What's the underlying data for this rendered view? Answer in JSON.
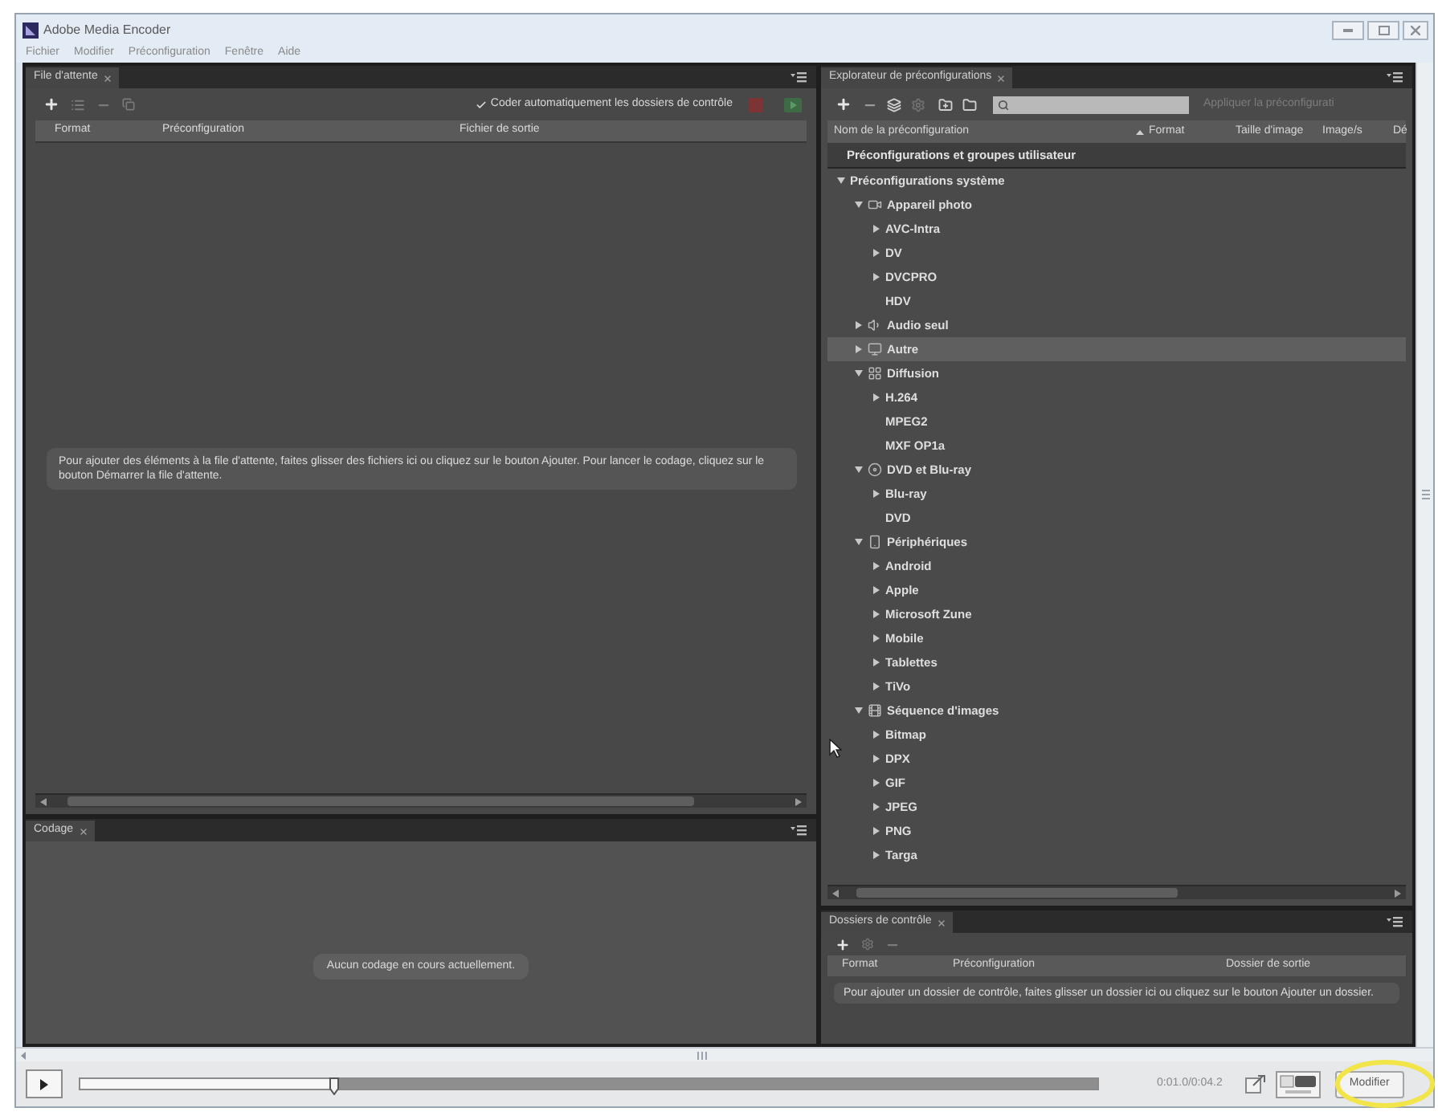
{
  "window": {
    "title": "Adobe Media Encoder"
  },
  "menu": [
    "Fichier",
    "Modifier",
    "Préconfiguration",
    "Fenêtre",
    "Aide"
  ],
  "queue": {
    "tab": "File d'attente",
    "auto_encode": {
      "label": "Coder automatiquement les dossiers de contrôle",
      "checked": true
    },
    "columns": [
      "Format",
      "Préconfiguration",
      "Fichier de sortie"
    ],
    "message": "Pour ajouter des éléments à la file d'attente, faites glisser des fichiers ici ou cliquez sur le bouton Ajouter. Pour lancer le codage, cliquez sur le bouton Démarrer la file d'attente."
  },
  "encoding": {
    "tab": "Codage",
    "message": "Aucun codage en cours actuellement."
  },
  "preset_browser": {
    "tab": "Explorateur de préconfigurations",
    "apply_label": "Appliquer la préconfigurati",
    "columns": [
      {
        "label": "Nom de la préconfiguration",
        "sorted": false
      },
      {
        "label": "Format",
        "sorted": true
      },
      {
        "label": "Taille d'image",
        "sorted": false
      },
      {
        "label": "Image/s",
        "sorted": false
      },
      {
        "label": "Dé",
        "sorted": false
      }
    ],
    "user_presets": "Préconfigurations et groupes utilisateur",
    "tree": [
      {
        "label": "Préconfigurations système",
        "kind": "group",
        "expanded": true,
        "selected": false,
        "children": [
          {
            "label": "Appareil photo",
            "kind": "group",
            "expanded": true,
            "selected": false,
            "children": [
              {
                "label": "AVC-Intra",
                "kind": "group",
                "expanded": false,
                "selected": false
              },
              {
                "label": "DV",
                "kind": "group",
                "expanded": false,
                "selected": false
              },
              {
                "label": "DVCPRO",
                "kind": "group",
                "expanded": false,
                "selected": false
              },
              {
                "label": "HDV",
                "kind": "preset",
                "selected": false
              }
            ]
          },
          {
            "label": "Audio seul",
            "kind": "group",
            "expanded": false,
            "selected": false
          },
          {
            "label": "Autre",
            "kind": "group",
            "expanded": false,
            "selected": true
          },
          {
            "label": "Diffusion",
            "kind": "group",
            "expanded": true,
            "selected": false,
            "children": [
              {
                "label": "H.264",
                "kind": "group",
                "expanded": false,
                "selected": false
              },
              {
                "label": "MPEG2",
                "kind": "preset",
                "selected": false
              },
              {
                "label": "MXF OP1a",
                "kind": "preset",
                "selected": false
              }
            ]
          },
          {
            "label": "DVD et Blu-ray",
            "kind": "group",
            "expanded": true,
            "selected": false,
            "children": [
              {
                "label": "Blu-ray",
                "kind": "group",
                "expanded": false,
                "selected": false
              },
              {
                "label": "DVD",
                "kind": "preset",
                "selected": false
              }
            ]
          },
          {
            "label": "Périphériques",
            "kind": "group",
            "expanded": true,
            "selected": false,
            "children": [
              {
                "label": "Android",
                "kind": "group",
                "expanded": false,
                "selected": false
              },
              {
                "label": "Apple",
                "kind": "group",
                "expanded": false,
                "selected": false
              },
              {
                "label": "Microsoft Zune",
                "kind": "group",
                "expanded": false,
                "selected": false
              },
              {
                "label": "Mobile",
                "kind": "group",
                "expanded": false,
                "selected": false
              },
              {
                "label": "Tablettes",
                "kind": "group",
                "expanded": false,
                "selected": false
              },
              {
                "label": "TiVo",
                "kind": "group",
                "expanded": false,
                "selected": false
              }
            ]
          },
          {
            "label": "Séquence d'images",
            "kind": "group",
            "expanded": true,
            "selected": false,
            "children": [
              {
                "label": "Bitmap",
                "kind": "group",
                "expanded": false,
                "selected": false
              },
              {
                "label": "DPX",
                "kind": "group",
                "expanded": false,
                "selected": false
              },
              {
                "label": "GIF",
                "kind": "group",
                "expanded": false,
                "selected": false
              },
              {
                "label": "JPEG",
                "kind": "group",
                "expanded": false,
                "selected": false
              },
              {
                "label": "PNG",
                "kind": "group",
                "expanded": false,
                "selected": false
              },
              {
                "label": "Targa",
                "kind": "group",
                "expanded": false,
                "selected": false
              }
            ]
          }
        ]
      }
    ]
  },
  "watch_folders": {
    "tab": "Dossiers de contrôle",
    "columns": [
      "Format",
      "Préconfiguration",
      "Dossier de sortie"
    ],
    "message": "Pour ajouter un dossier de contrôle, faites glisser un dossier ici ou cliquez sur le bouton Ajouter un dossier."
  },
  "playback": {
    "level": 0.25,
    "time": "0:01.0/0:04.2"
  },
  "edit_button": "Modifier"
}
